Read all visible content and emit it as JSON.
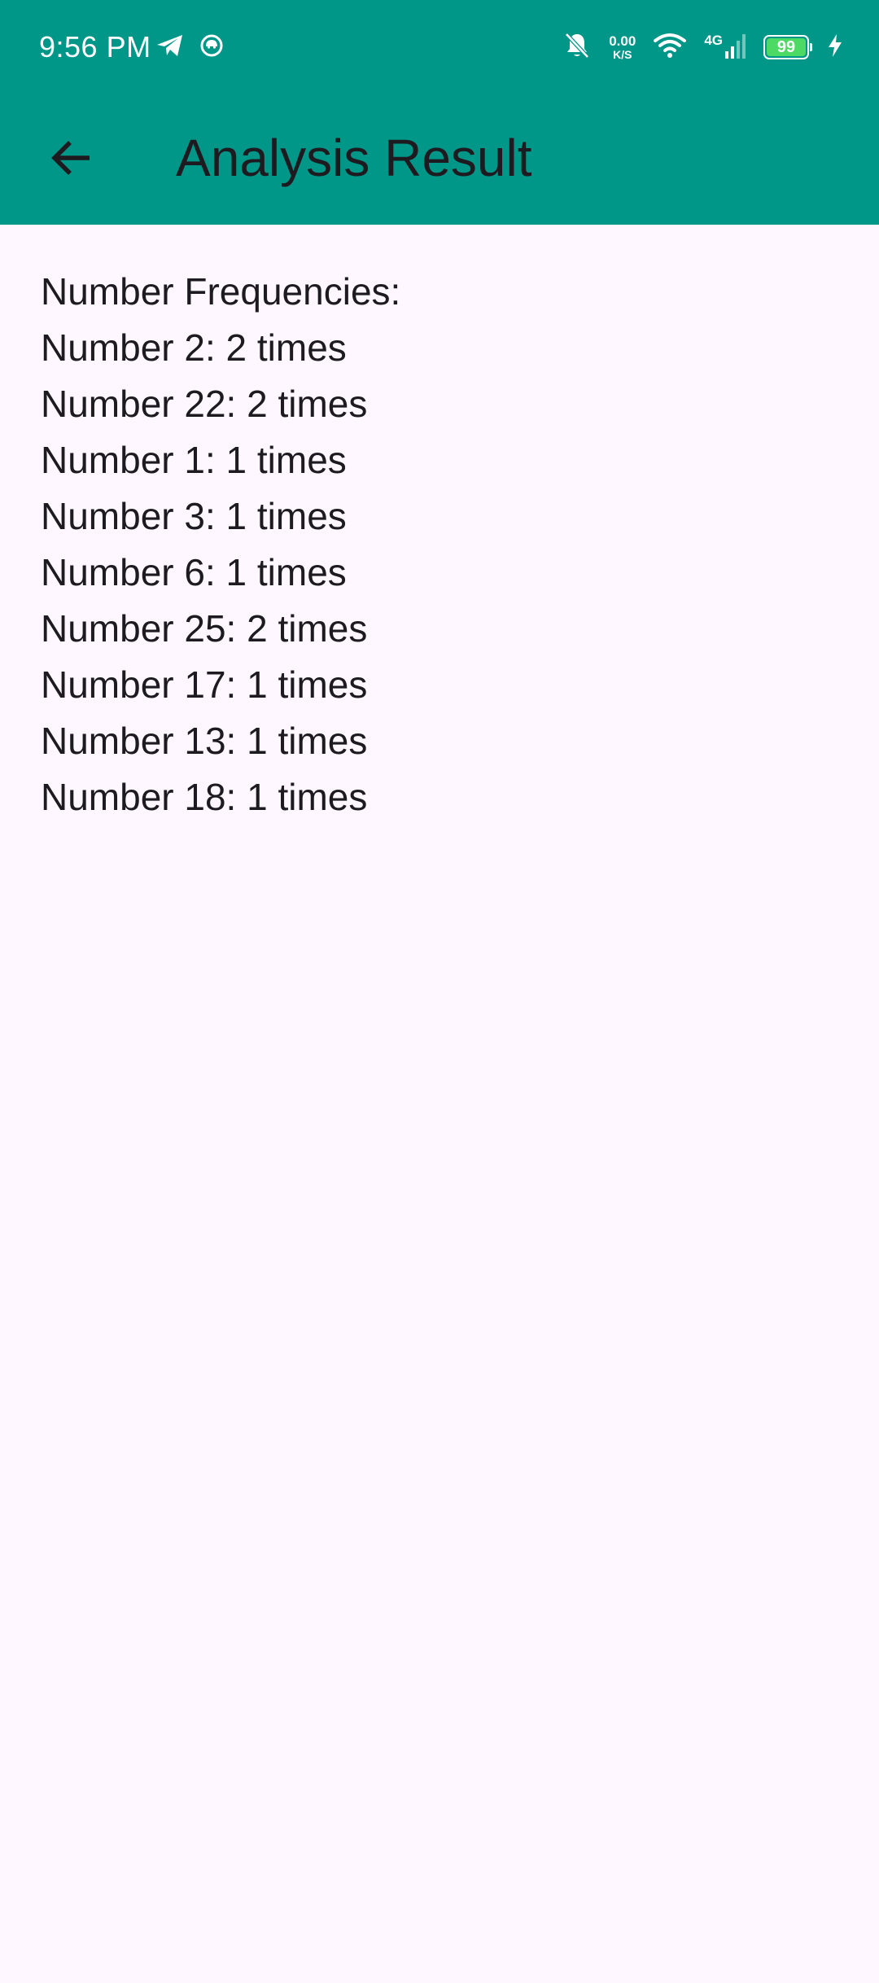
{
  "status_bar": {
    "time": "9:56 PM",
    "left_icons": [
      "telegram-icon",
      "app-notification-icon"
    ],
    "net_speed_value": "0.00",
    "net_speed_unit": "K/S",
    "network_type": "4G",
    "battery_level": "99",
    "battery_fraction": 0.99,
    "right_icons": [
      "notifications-off-icon",
      "wifi-icon",
      "cell-signal-icon",
      "battery-icon",
      "charging-icon"
    ]
  },
  "app_bar": {
    "title": "Analysis Result",
    "back_icon": "arrow-back-icon",
    "background": "#009688"
  },
  "content": {
    "heading": "Number Frequencies:",
    "frequencies": [
      "Number 2: 2 times",
      "Number 22: 2 times",
      "Number 1: 1 times",
      "Number 3: 1 times",
      "Number 6: 1 times",
      "Number 25: 2 times",
      "Number 17: 1 times",
      "Number 13: 1 times",
      "Number 18: 1 times"
    ]
  },
  "colors": {
    "primary": "#009688",
    "background": "#FEF7FF",
    "text": "#1D1B20",
    "battery_fill": "#4CD964"
  }
}
